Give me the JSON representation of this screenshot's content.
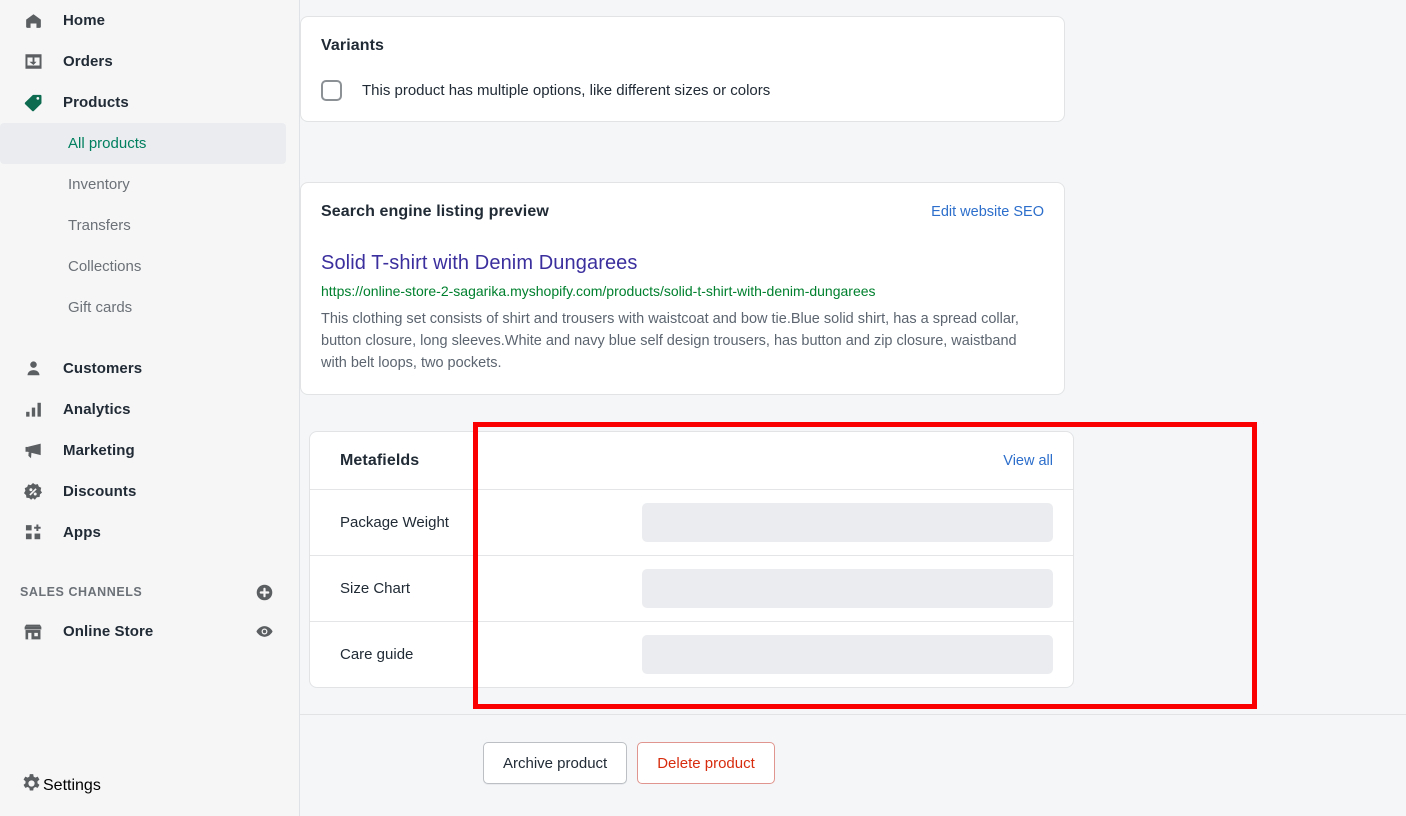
{
  "sidebar": {
    "primary_items": [
      {
        "label": "Home",
        "icon": "home-icon"
      },
      {
        "label": "Orders",
        "icon": "orders-inbox-icon"
      },
      {
        "label": "Products",
        "icon": "product-tag-icon"
      }
    ],
    "product_sub_items": [
      {
        "label": "All products",
        "active": true
      },
      {
        "label": "Inventory",
        "active": false
      },
      {
        "label": "Transfers",
        "active": false
      },
      {
        "label": "Collections",
        "active": false
      },
      {
        "label": "Gift cards",
        "active": false
      }
    ],
    "secondary_items": [
      {
        "label": "Customers",
        "icon": "customer-person-icon"
      },
      {
        "label": "Analytics",
        "icon": "analytics-bars-icon"
      },
      {
        "label": "Marketing",
        "icon": "marketing-megaphone-icon"
      },
      {
        "label": "Discounts",
        "icon": "discount-percent-icon"
      },
      {
        "label": "Apps",
        "icon": "apps-grid-plus-icon"
      }
    ],
    "sales_channels": {
      "heading": "SALES CHANNELS",
      "add_icon": "plus-circle-icon",
      "items": [
        {
          "label": "Online Store",
          "icon": "store-front-icon",
          "trailing_icon": "eye-icon"
        }
      ]
    },
    "settings": {
      "label": "Settings",
      "icon": "gear-icon"
    },
    "accent_color": "#007f5f"
  },
  "variants": {
    "title": "Variants",
    "checkbox_label": "This product has multiple options, like different sizes or colors",
    "checked": false
  },
  "seo": {
    "title": "Search engine listing preview",
    "edit_link": "Edit website SEO",
    "listing_title": "Solid T-shirt with Denim Dungarees",
    "listing_url": "https://online-store-2-sagarika.myshopify.com/products/solid-t-shirt-with-denim-dungarees",
    "listing_description": "This clothing set consists of shirt and trousers with waistcoat and bow tie.Blue solid shirt, has a spread collar, button closure, long sleeves.White and navy blue self design trousers, has button and zip closure, waistband with belt loops, two pockets.",
    "link_color": "#2c6ecb",
    "title_color": "#3b2f9e",
    "url_color": "#00802e"
  },
  "metafields": {
    "title": "Metafields",
    "view_all_link": "View all",
    "rows": [
      {
        "label": "Package Weight",
        "value": "",
        "placeholder": ""
      },
      {
        "label": "Size Chart",
        "value": "",
        "placeholder": ""
      },
      {
        "label": "Care guide",
        "value": "",
        "placeholder": ""
      }
    ],
    "highlight_color": "#fb0000"
  },
  "actions": {
    "archive_label": "Archive product",
    "delete_label": "Delete product",
    "danger_color": "#d72c0d"
  }
}
